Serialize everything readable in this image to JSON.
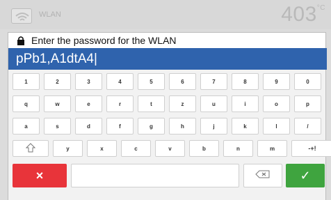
{
  "header": {
    "title": "WLAN",
    "temperature": "403",
    "unit": "°C"
  },
  "dialog": {
    "title": "Enter the password for the WLAN",
    "password_value": "pPb1,A1dtA4|"
  },
  "keyboard": {
    "rows": [
      [
        "1",
        "2",
        "3",
        "4",
        "5",
        "6",
        "7",
        "8",
        "9",
        "0"
      ],
      [
        "q",
        "w",
        "e",
        "r",
        "t",
        "z",
        "u",
        "i",
        "o",
        "p"
      ],
      [
        "a",
        "s",
        "d",
        "f",
        "g",
        "h",
        "j",
        "k",
        "l",
        "/"
      ],
      [
        "shift",
        "y",
        "x",
        "c",
        "v",
        "b",
        "n",
        "m",
        "-+!"
      ]
    ]
  },
  "actions": {
    "cancel_label": "×",
    "ok_label": "✓"
  },
  "colors": {
    "input_bg": "#2f63ad",
    "cancel": "#e8343a",
    "ok": "#3fa43f"
  },
  "icons": [
    "wifi-icon",
    "lock-icon",
    "shift-icon",
    "backspace-icon"
  ]
}
